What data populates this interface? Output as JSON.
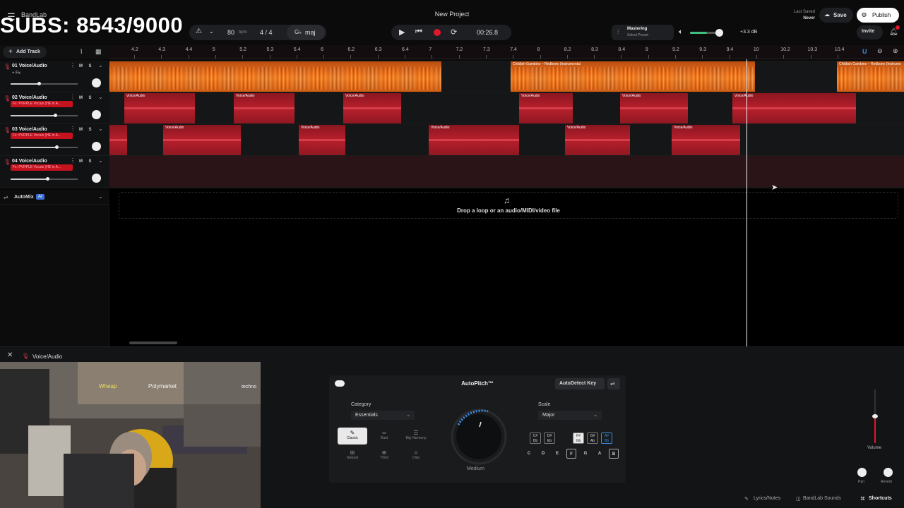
{
  "overlay": {
    "subs": "SUBS: 8543/9000"
  },
  "app": {
    "logo": "BandLab",
    "project_title": "New Project"
  },
  "transport": {
    "bpm": "80",
    "bpm_unit": "bpm",
    "time_sig": "4 / 4",
    "key": "maj",
    "time": "00:26.8"
  },
  "mastering": {
    "title": "Mastering",
    "subtitle": "Select Preset",
    "volume_db": "+3.3 dB"
  },
  "header": {
    "last_saved_label": "Last Saved",
    "last_saved_value": "Never",
    "save": "Save",
    "publish": "Publish",
    "invite": "Invite"
  },
  "ruler": {
    "ticks": [
      "4.2",
      "4.3",
      "4.4",
      "5",
      "5.2",
      "5.3",
      "5.4",
      "6",
      "6.2",
      "6.3",
      "6.4",
      "7",
      "7.2",
      "7.3",
      "7.4",
      "8",
      "8.2",
      "8.3",
      "8.4",
      "9",
      "9.2",
      "9.3",
      "9.4",
      "10",
      "10.2",
      "10.3",
      "10.4"
    ]
  },
  "toolbar": {
    "add_track": "Add Track"
  },
  "tracks": [
    {
      "name": "01  Voice/Audio",
      "fx": "+ Fx",
      "plugin": "",
      "mute": "M",
      "solo": "S",
      "volume": 0.42
    },
    {
      "name": "02  Voice/Audio",
      "fx": "",
      "plugin": "Fx: PVRPLE Vocals (HE in A...",
      "mute": "M",
      "solo": "S",
      "volume": 0.66
    },
    {
      "name": "03  Voice/Audio",
      "fx": "",
      "plugin": "Fx: PVRPLE Vocals (HE in A...",
      "mute": "M",
      "solo": "S",
      "volume": 0.68
    },
    {
      "name": "04  Voice/Audio",
      "fx": "",
      "plugin": "Fx: PVRPLE Vocals (HE in A...",
      "mute": "M",
      "solo": "S",
      "volume": 0.55
    }
  ],
  "clips": {
    "orange_1": "",
    "orange_2": "Childish Gambino – Redbone (Instrumental",
    "orange_3": "Childish Gambino – Redbone (Instrume",
    "voice": "Voice/Audio"
  },
  "automix": {
    "label": "AutoMix",
    "badge": "AI"
  },
  "drop": {
    "text": "Drop a loop or an audio/MIDI/video file"
  },
  "bottom": {
    "track_label": "Voice/Audio"
  },
  "autopitch": {
    "title": "AutoPitch™",
    "autodetect": "AutoDetect Key",
    "category_label": "Category",
    "category_value": "Essentials",
    "scale_label": "Scale",
    "scale_value": "Major",
    "knob_label": "Medium",
    "modes": [
      "Classic",
      "Duet",
      "Big Harmony",
      "Natural",
      "Third",
      "Chip"
    ],
    "sharp_keys": [
      {
        "top": "C#",
        "bottom": "Db"
      },
      {
        "top": "D#",
        "bottom": "Eb"
      },
      {
        "top": "F#",
        "bottom": "Gb"
      },
      {
        "top": "G#",
        "bottom": "Ab"
      },
      {
        "top": "A#",
        "bottom": "Bb"
      }
    ],
    "natural_keys": [
      "C",
      "D",
      "E",
      "F",
      "G",
      "A",
      "B"
    ]
  },
  "mixer": {
    "volume_label": "Volume",
    "pan_label": "Pan",
    "reverb_label": "Reverb"
  },
  "footer": {
    "lyrics": "Lyrics/Notes",
    "sounds": "BandLab Sounds",
    "shortcuts": "Shortcuts"
  },
  "colors": {
    "accent_red": "#d9142a",
    "clip_orange": "#f07f24",
    "clip_red": "#b81f2c",
    "autopitch_blue": "#3a8ee6"
  }
}
